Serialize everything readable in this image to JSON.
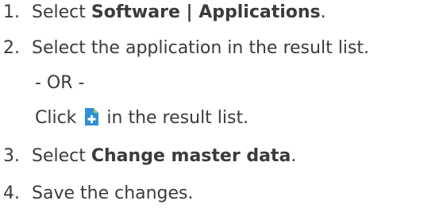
{
  "steps": [
    {
      "number": "1.",
      "prefix": "Select ",
      "bold": "Software | Applications",
      "suffix": "."
    },
    {
      "number": "2.",
      "text": "Select the application in the result list."
    },
    {
      "number": "3.",
      "prefix": "Select ",
      "bold": "Change master data",
      "suffix": "."
    },
    {
      "number": "4.",
      "text": "Save the changes."
    }
  ],
  "alternative": {
    "separator": "- OR -",
    "click_prefix": "Click ",
    "click_suffix": " in the result list.",
    "icon": "new-document-plus-icon",
    "icon_colors": {
      "body": "#2f8fd8",
      "plus": "#ffffff",
      "corner": "#9ed06a"
    }
  }
}
